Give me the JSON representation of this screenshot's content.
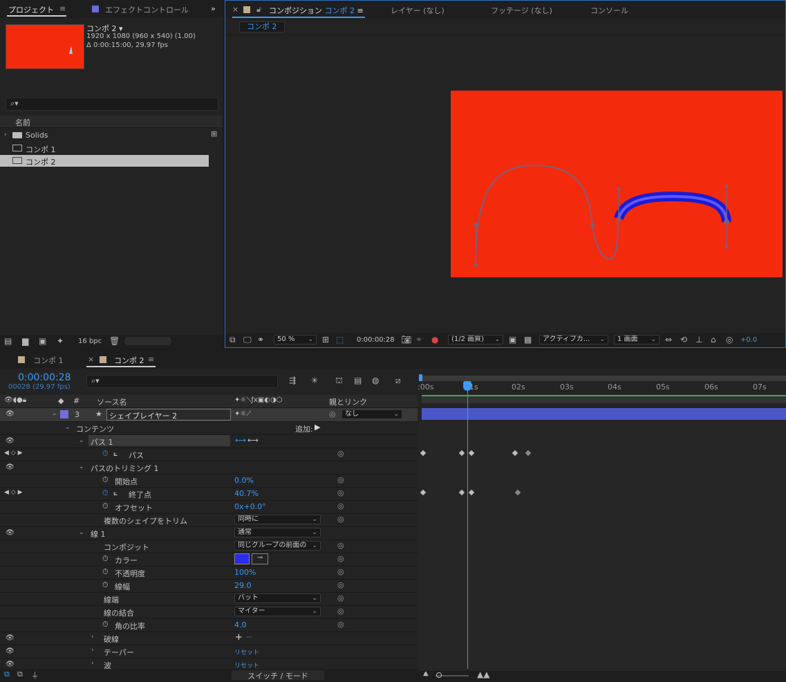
{
  "project_panel": {
    "tab_label": "プロジェクト",
    "effects_tab_label": "エフェクトコントロール",
    "comp_name": "コンポ 2 ▾",
    "comp_size": "1920 x 1080  (960 x 540) (1.00)",
    "comp_duration": "Δ 0:00:15:00, 29.97 fps",
    "column_name": "名前",
    "items": [
      {
        "label": "Solids",
        "icon": "folder-icon"
      },
      {
        "label": "コンポ 1",
        "icon": "comp-icon"
      },
      {
        "label": "コンポ 2",
        "icon": "comp-icon"
      }
    ],
    "bpc_label": "16 bpc"
  },
  "composition_panel": {
    "tab_prefix": "コンポジション",
    "tab_comp": "コンポ 2",
    "layer_tab": "レイヤー (なし)",
    "footage_tab": "フッテージ (なし)",
    "console_tab": "コンソール",
    "breadcrumb": "コンポ 2",
    "zoom": "50 %",
    "timecode": "0:00:00:28",
    "resolution": "(1/2 画質)",
    "camera": "アクティブカ...",
    "views": "1 画面",
    "exposure": "+0.0",
    "canvas_color": "#f42a0c",
    "stroke_color": "#3230e8"
  },
  "timeline": {
    "tab1": "コンポ 1",
    "tab2": "コンポ 2",
    "current_time": "0:00:00:28",
    "current_frame": "00028 (29.97 fps)",
    "header_source": "ソース名",
    "header_parent": "親とリンク",
    "ruler_labels": [
      ":00s",
      "01s",
      "02s",
      "03s",
      "04s",
      "05s",
      "06s",
      "07s"
    ],
    "layer": {
      "num": "3",
      "name": "シェイプレイヤー 2",
      "parent": "なし",
      "color": "#6f6fd9"
    },
    "contents_label": "コンテンツ",
    "add_label": "追加:",
    "path_group": "パス 1",
    "path_prop": "パス",
    "trim_group": "パスのトリミング 1",
    "start_label": "開始点",
    "start_value": "0.0%",
    "end_label": "終了点",
    "end_value": "40.7%",
    "offset_label": "オフセット",
    "offset_value": "0x+0.0°",
    "trim_multi_label": "複数のシェイプをトリム",
    "trim_multi_value": "同時に",
    "stroke_group": "線 1",
    "stroke_mode": "通常",
    "composite_label": "コンポジット",
    "composite_value": "同じグループの前面の",
    "color_label": "カラー",
    "color_value": "#2b2bec",
    "opacity_label": "不透明度",
    "opacity_value": "100%",
    "width_label": "線幅",
    "width_value": "29.0",
    "cap_label": "線端",
    "cap_value": "バット",
    "join_label": "線の結合",
    "join_value": "マイター",
    "miter_label": "角の比率",
    "miter_value": "4.0",
    "dash_label": "破線",
    "taper_label": "テーパー",
    "taper_value": "リセット",
    "wave_label": "波",
    "wave_value": "リセット",
    "footer_label": "スイッチ / モード"
  }
}
